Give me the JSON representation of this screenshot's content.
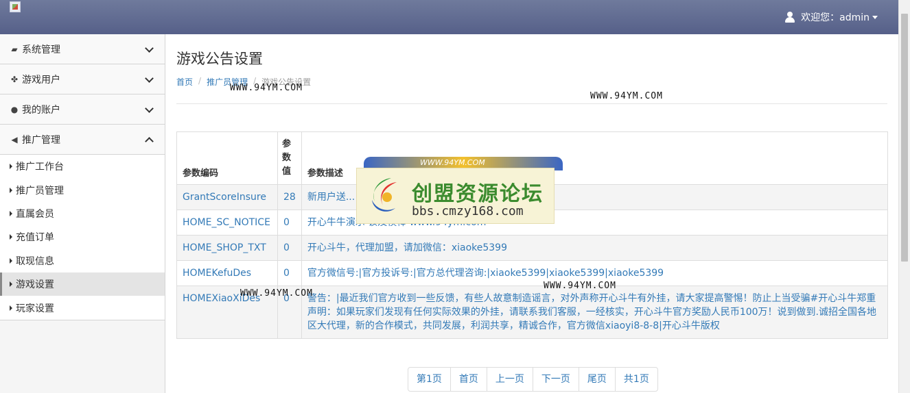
{
  "header": {
    "welcome": "欢迎您：admin"
  },
  "sidebar": {
    "groups": [
      {
        "label": "系统管理",
        "icon": "briefcase-icon"
      },
      {
        "label": "游戏用户",
        "icon": "gamepad-icon"
      },
      {
        "label": "我的账户",
        "icon": "user-icon"
      },
      {
        "label": "推广管理",
        "icon": "bullhorn-icon"
      }
    ],
    "items": [
      {
        "label": "推广工作台"
      },
      {
        "label": "推广员管理"
      },
      {
        "label": "直属会员"
      },
      {
        "label": "充值订单"
      },
      {
        "label": "取现信息"
      },
      {
        "label": "游戏设置"
      },
      {
        "label": "玩家设置"
      }
    ]
  },
  "main": {
    "title": "游戏公告设置",
    "breadcrumb": [
      "首页",
      "推广员管理",
      "游戏公告设置"
    ],
    "table": {
      "headers": [
        "参数编码",
        "参数值",
        "参数描述"
      ],
      "rows": [
        {
          "code": "GrantScoreInsure",
          "value": "28",
          "desc": "新用户送..."
        },
        {
          "code": "HOME_SC_NOTICE",
          "value": "0",
          "desc": "开心牛牛演示 该及模棒 www.94ym.com"
        },
        {
          "code": "HOME_SHOP_TXT",
          "value": "0",
          "desc": "开心斗牛，代理加盟，请加微信：xiaoke5399"
        },
        {
          "code": "HOMEKefuDes",
          "value": "0",
          "desc": "官方微信号:|官方投诉号:|官方总代理咨询:|xiaoke5399|xiaoke5399|xiaoke5399"
        },
        {
          "code": "HOMEXiaoXiDes",
          "value": "0",
          "desc": "警告：|最近我们官方收到一些反馈，有些人故意制造谣言，对外声称开心斗牛有外挂，请大家提高警惕！防止上当受骗#开心斗牛郑重声明：如果玩家们发现有任何实际效果的外挂，请联系我们客服，一经核实，开心斗牛官方奖励人民币100万！说到做到.诚招全国各地区大代理，新的合作模式，共同发展，利润共享，精诚合作，官方微信xiaoyi8-8-8|开心斗牛版权"
        }
      ]
    },
    "pager": [
      "第1页",
      "首页",
      "上一页",
      "下一页",
      "尾页",
      "共1页"
    ]
  },
  "watermarks": {
    "site": "WWW.94YM.COM",
    "banner_small": "WWW.94YM.COM",
    "banner_title": "创盟资源论坛",
    "banner_url": "bbs.cmzy168.com"
  }
}
